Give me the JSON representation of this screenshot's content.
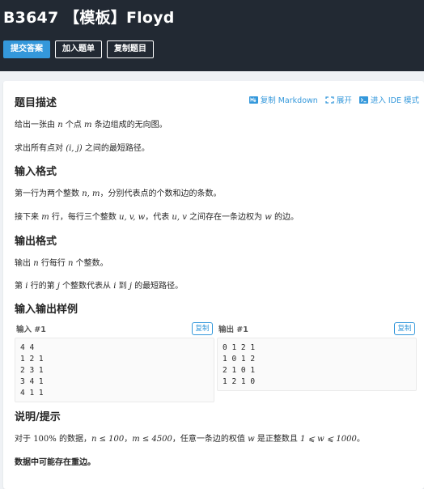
{
  "header": {
    "title": "B3647 【模板】Floyd",
    "submit_label": "提交答案",
    "add_plan_label": "加入题单",
    "copy_problem_label": "复制题目"
  },
  "toolbar": {
    "copy_markdown": "复制 Markdown",
    "expand": "展开",
    "ide_mode": "进入 IDE 模式"
  },
  "description": {
    "heading": "题目描述",
    "line1_a": "给出一张由",
    "line1_n": "n",
    "line1_b": "个点",
    "line1_m": "m",
    "line1_c": "条边组成的无向图。",
    "line2_a": "求出所有点对",
    "line2_pair": "(i, j)",
    "line2_b": "之间的最短路径。"
  },
  "input_format": {
    "heading": "输入格式",
    "line1_a": "第一行为两个整数",
    "line1_vars": "n, m",
    "line1_b": "，分别代表点的个数和边的条数。",
    "line2_a": "接下来",
    "line2_m": "m",
    "line2_b": "行，每行三个整数",
    "line2_vars": "u, v, w",
    "line2_c": "，代表",
    "line2_uv": "u, v",
    "line2_d": "之间存在一条边权为",
    "line2_w": "w",
    "line2_e": "的边。"
  },
  "output_format": {
    "heading": "输出格式",
    "line1_a": "输出",
    "line1_n1": "n",
    "line1_b": "行每行",
    "line1_n2": "n",
    "line1_c": "个整数。",
    "line2_a": "第",
    "line2_i": "i",
    "line2_b": "行的第",
    "line2_j": "j",
    "line2_c": "个整数代表从",
    "line2_i2": "i",
    "line2_d": "到",
    "line2_j2": "j",
    "line2_e": "的最短路径。"
  },
  "samples": {
    "heading": "输入输出样例",
    "input_label": "输入 #1",
    "output_label": "输出 #1",
    "copy_label": "复制",
    "input_lines": [
      "4 4",
      "1 2 1",
      "2 3 1",
      "3 4 1",
      "4 1 1"
    ],
    "output_lines": [
      "0 1 2 1",
      "1 0 1 2",
      "2 1 0 1",
      "1 2 1 0"
    ]
  },
  "hint": {
    "heading": "说明/提示",
    "line1_a": "对于",
    "line1_pct": "100%",
    "line1_b": "的数据，",
    "line1_c1": "n ≤ 100",
    "line1_c2": "m ≤ 4500",
    "line1_c": "，任意一条边的权值",
    "line1_w": "w",
    "line1_d": "是正整数且",
    "line1_range": "1 ⩽ w ⩽ 1000",
    "line1_e": "。",
    "line2": "数据中可能存在重边。"
  },
  "colors": {
    "header_bg": "#222933",
    "accent": "#3498db",
    "page_bg": "#eff2f5"
  }
}
